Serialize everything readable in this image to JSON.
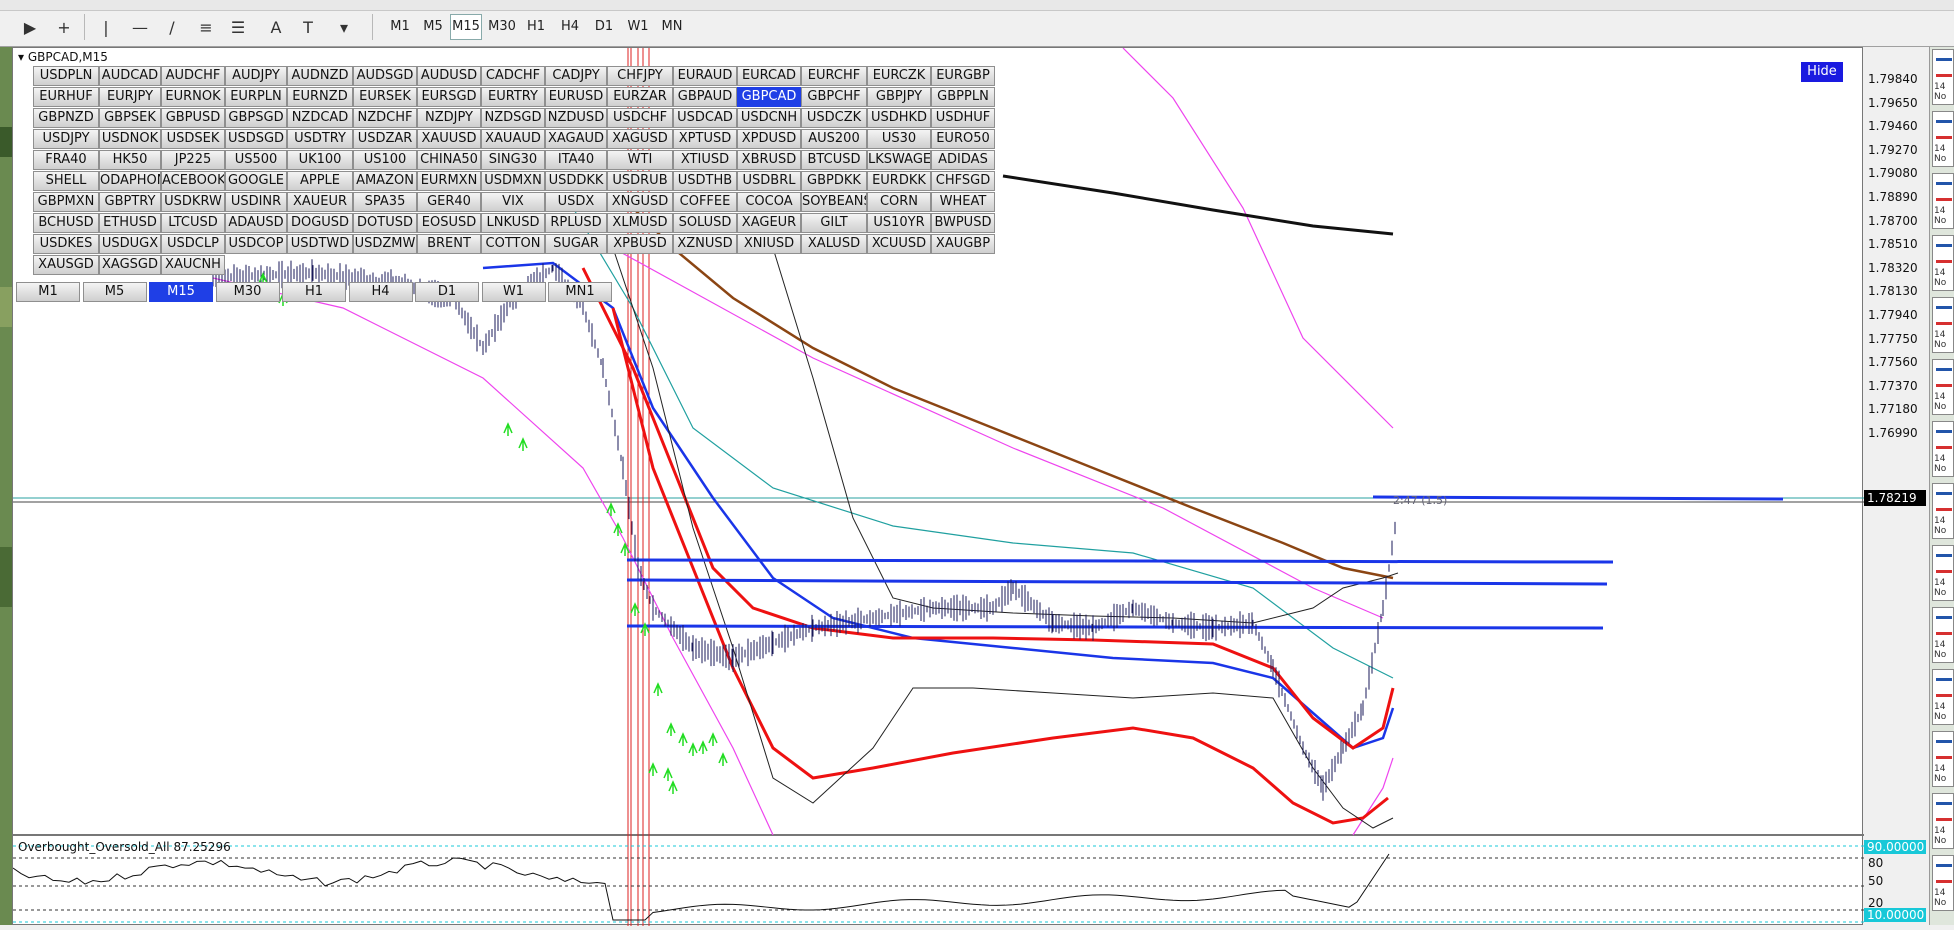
{
  "toolbar": {
    "timeframes": [
      "M1",
      "M5",
      "M15",
      "M30",
      "H1",
      "H4",
      "D1",
      "W1",
      "MN"
    ],
    "active_timeframe": "M15"
  },
  "chart": {
    "title": "GBPCAD,M15",
    "hide_label": "Hide",
    "current_price": "1.78219",
    "price_labels": [
      "1.79840",
      "1.79650",
      "1.79460",
      "1.79270",
      "1.79080",
      "1.78890",
      "1.78700",
      "1.78510",
      "1.78320",
      "1.78130",
      "1.77940",
      "1.77750",
      "1.77560",
      "1.77370",
      "1.77180",
      "1.76990"
    ],
    "annotation": "2:47 (1.5)"
  },
  "symbols": [
    [
      "USDPLN",
      "AUDCAD",
      "AUDCHF",
      "AUDJPY",
      "AUDNZD",
      "AUDSGD",
      "AUDUSD",
      "CADCHF",
      "CADJPY",
      "CHFJPY",
      "EURAUD",
      "EURCAD",
      "EURCHF",
      "EURCZK",
      "EURGBP"
    ],
    [
      "EURHUF",
      "EURJPY",
      "EURNOK",
      "EURPLN",
      "EURNZD",
      "EURSEK",
      "EURSGD",
      "EURTRY",
      "EURUSD",
      "EURZAR",
      "GBPAUD",
      "GBPCAD",
      "GBPCHF",
      "GBPJPY",
      "GBPPLN"
    ],
    [
      "GBPNZD",
      "GBPSEK",
      "GBPUSD",
      "GBPSGD",
      "NZDCAD",
      "NZDCHF",
      "NZDJPY",
      "NZDSGD",
      "NZDUSD",
      "USDCHF",
      "USDCAD",
      "USDCNH",
      "USDCZK",
      "USDHKD",
      "USDHUF"
    ],
    [
      "USDJPY",
      "USDNOK",
      "USDSEK",
      "USDSGD",
      "USDTRY",
      "USDZAR",
      "XAUUSD",
      "XAUAUD",
      "XAGAUD",
      "XAGUSD",
      "XPTUSD",
      "XPDUSD",
      "AUS200",
      "US30",
      "EURO50"
    ],
    [
      "FRA40",
      "HK50",
      "JP225",
      "US500",
      "UK100",
      "US100",
      "CHINA50",
      "SING30",
      "ITA40",
      "WTI",
      "XTIUSD",
      "XBRUSD",
      "BTCUSD",
      "LKSWAGEN",
      "ADIDAS"
    ],
    [
      "SHELL",
      "ODAPHONE",
      "ACEBOOK",
      "GOOGLE",
      "APPLE",
      "AMAZON",
      "EURMXN",
      "USDMXN",
      "USDDKK",
      "USDRUB",
      "USDTHB",
      "USDBRL",
      "GBPDKK",
      "EURDKK",
      "CHFSGD"
    ],
    [
      "GBPMXN",
      "GBPTRY",
      "USDKRW",
      "USDINR",
      "XAUEUR",
      "SPA35",
      "GER40",
      "VIX",
      "USDX",
      "XNGUSD",
      "COFFEE",
      "COCOA",
      "SOYBEANS",
      "CORN",
      "WHEAT"
    ],
    [
      "BCHUSD",
      "ETHUSD",
      "LTCUSD",
      "ADAUSD",
      "DOGUSD",
      "DOTUSD",
      "EOSUSD",
      "LNKUSD",
      "RPLUSD",
      "XLMUSD",
      "SOLUSD",
      "XAGEUR",
      "GILT",
      "US10YR",
      "BWPUSD"
    ],
    [
      "USDKES",
      "USDUGX",
      "USDCLP",
      "USDCOP",
      "USDTWD",
      "USDZMW",
      "BRENT",
      "COTTON",
      "SUGAR",
      "XPBUSD",
      "XZNUSD",
      "XNIUSD",
      "XALUSD",
      "XCUUSD",
      "XAUGBP"
    ],
    [
      "XAUSGD",
      "XAGSGD",
      "XAUCNH"
    ]
  ],
  "active_symbol": "GBPCAD",
  "panel_timeframes": [
    "M1",
    "M5",
    "M15",
    "M30",
    "H1",
    "H4",
    "D1",
    "W1",
    "MN1"
  ],
  "panel_active_timeframe": "M15",
  "indicator": {
    "title": "Overbought_Oversold_All 87.25296",
    "levels": [
      "80",
      "50",
      "20"
    ],
    "highlight_top": "90.00000",
    "highlight_bottom": "10.00000"
  },
  "thumb_label": "14 No",
  "colors": {
    "ma_red": "#ee1111",
    "ma_blue": "#1a35e8",
    "ma_brown": "#8b4513",
    "ma_black": "#111111",
    "band_magenta": "#ee44ee",
    "signal_green": "#22dd22",
    "active_blue": "#1f3fe6"
  }
}
